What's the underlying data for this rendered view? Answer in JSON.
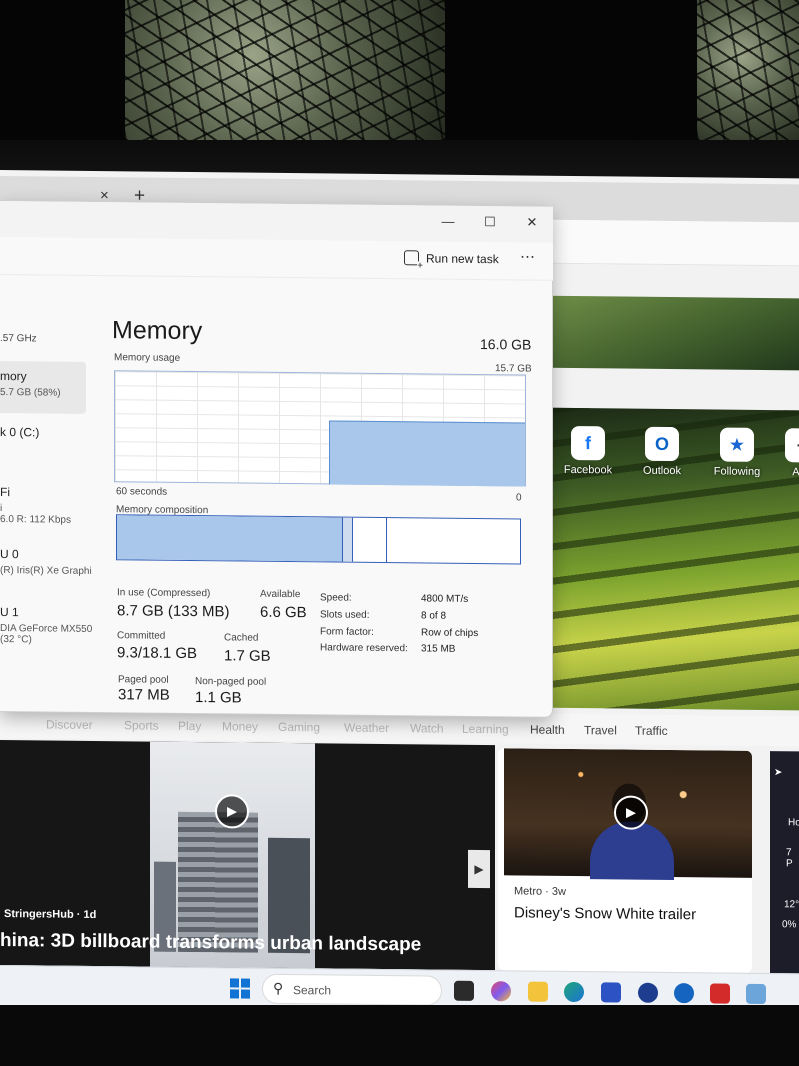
{
  "browser": {
    "tab_close": "×",
    "tab_add": "+",
    "quick_links": [
      "Facebook",
      "Outlook",
      "Following",
      "Add"
    ],
    "news_tabs": [
      "Discover",
      "Sports",
      "Play",
      "Money",
      "Gaming",
      "Weather",
      "Watch",
      "Learning",
      "Health",
      "Travel",
      "Traffic"
    ],
    "card_left": {
      "source": "StringersHub · 1d",
      "headline": "hina: 3D billboard transforms urban landscape"
    },
    "card_right": {
      "source": "Metro · 3w",
      "headline": "Disney's Snow White trailer"
    },
    "card_edge": [
      "Ho",
      "7 P",
      "12°",
      "0%"
    ],
    "colors": {
      "accent": "#1173d4"
    }
  },
  "taskbar": {
    "search_placeholder": "Search"
  },
  "taskmgr": {
    "window_buttons": [
      "—",
      "☐",
      "✕"
    ],
    "run_new_task": "Run new task",
    "more": "⋯",
    "sidebar": [
      {
        "label": ".57 GHz",
        "sub": ""
      },
      {
        "label": "mory",
        "sub": "5.7 GB (58%)"
      },
      {
        "label": "k 0 (C:)",
        "sub": ""
      },
      {
        "label": "Fi",
        "sub": "i\n6.0 R: 112 Kbps"
      },
      {
        "label": "U 0",
        "sub": "(R) Iris(R) Xe Graphi"
      },
      {
        "label": "U 1",
        "sub": "DIA GeForce MX550\n(32 °C)"
      }
    ],
    "memory": {
      "title": "Memory",
      "total": "16.0 GB",
      "usage_label": "Memory usage",
      "usage_max": "15.7 GB",
      "time_span": "60 seconds",
      "axis_zero": "0",
      "composition_label": "Memory composition",
      "in_use_label": "In use (Compressed)",
      "in_use_value": "8.7 GB (133 MB)",
      "available_label": "Available",
      "available_value": "6.6 GB",
      "committed_label": "Committed",
      "committed_value": "9.3/18.1 GB",
      "cached_label": "Cached",
      "cached_value": "1.7 GB",
      "paged_label": "Paged pool",
      "paged_value": "317 MB",
      "nonpaged_label": "Non-paged pool",
      "nonpaged_value": "1.1 GB",
      "details": [
        {
          "key": "Speed:",
          "value": "4800 MT/s"
        },
        {
          "key": "Slots used:",
          "value": "8 of 8"
        },
        {
          "key": "Form factor:",
          "value": "Row of chips"
        },
        {
          "key": "Hardware reserved:",
          "value": "315 MB"
        }
      ]
    }
  }
}
